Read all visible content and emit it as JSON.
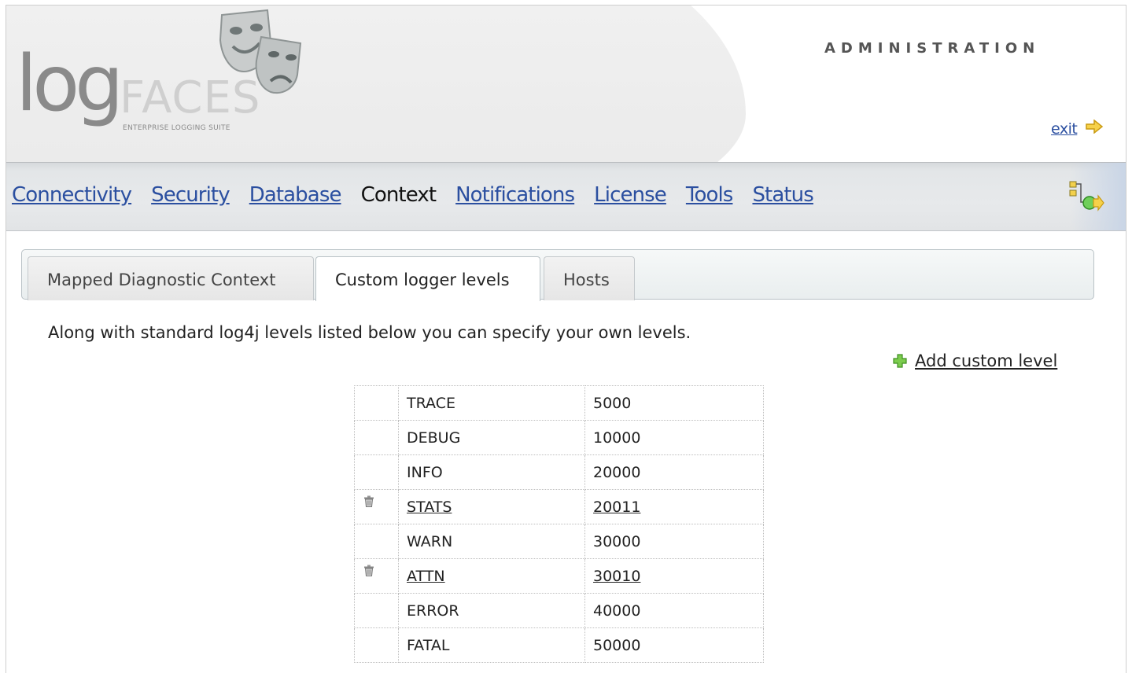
{
  "header": {
    "logo": {
      "word_log": "log",
      "word_faces": "FACES",
      "tagline": "ENTERPRISE LOGGING SUITE"
    },
    "title": "ADMINISTRATION",
    "exit_label": "exit"
  },
  "nav": {
    "items": [
      {
        "label": "Connectivity",
        "active": false
      },
      {
        "label": "Security",
        "active": false
      },
      {
        "label": "Database",
        "active": false
      },
      {
        "label": "Context",
        "active": true
      },
      {
        "label": "Notifications",
        "active": false
      },
      {
        "label": "License",
        "active": false
      },
      {
        "label": "Tools",
        "active": false
      },
      {
        "label": "Status",
        "active": false
      }
    ]
  },
  "tabs": [
    {
      "label": "Mapped Diagnostic Context",
      "active": false
    },
    {
      "label": "Custom logger levels",
      "active": true
    },
    {
      "label": "Hosts",
      "active": false
    }
  ],
  "content": {
    "intro": "Along with standard log4j levels listed below you can specify your own levels.",
    "add_label": "Add custom level"
  },
  "levels": [
    {
      "name": "TRACE",
      "value": "5000",
      "custom": false
    },
    {
      "name": "DEBUG",
      "value": "10000",
      "custom": false
    },
    {
      "name": "INFO",
      "value": "20000",
      "custom": false
    },
    {
      "name": "STATS",
      "value": "20011",
      "custom": true
    },
    {
      "name": "WARN",
      "value": "30000",
      "custom": false
    },
    {
      "name": "ATTN",
      "value": "30010",
      "custom": true
    },
    {
      "name": "ERROR",
      "value": "40000",
      "custom": false
    },
    {
      "name": "FATAL",
      "value": "50000",
      "custom": false
    }
  ],
  "icons": {
    "masks": "theater-masks-icon",
    "exit": "arrow-right-icon",
    "nav_action": "tree-connect-icon",
    "add": "plus-icon",
    "delete": "trash-icon"
  },
  "colors": {
    "link": "#2b4fa0",
    "accent_green": "#5cb85c",
    "arrow_yellow": "#f0c419"
  }
}
